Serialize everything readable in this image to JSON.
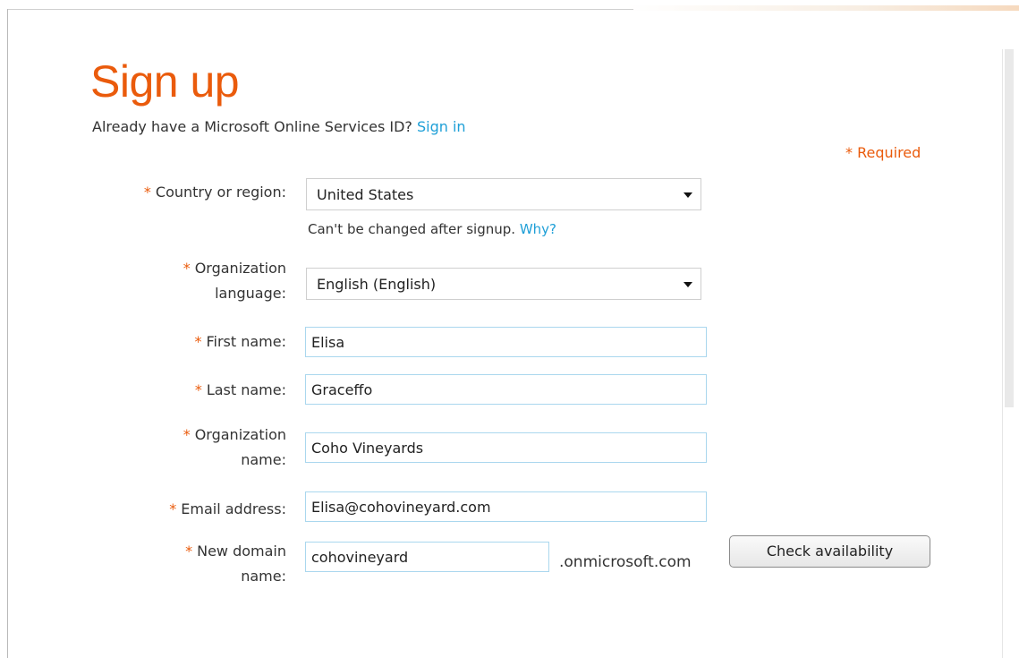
{
  "page": {
    "title": "Sign up",
    "subtitle_text": "Already have a Microsoft Online Services ID?",
    "signin_link": "Sign in",
    "required_note": "* Required"
  },
  "form": {
    "required_marker": "*",
    "country": {
      "label": "Country or region:",
      "value": "United States",
      "help_text": "Can't be changed after signup.",
      "help_link": "Why?"
    },
    "language": {
      "label_line1": "Organization",
      "label_line2": "language:",
      "value": "English (English)"
    },
    "first_name": {
      "label": "First name:",
      "value": "Elisa"
    },
    "last_name": {
      "label": "Last name:",
      "value": "Graceffo"
    },
    "organization_name": {
      "label_line1": "Organization",
      "label_line2": "name:",
      "value": "Coho Vineyards"
    },
    "email": {
      "label": "Email address:",
      "value": "Elisa@cohovineyard.com"
    },
    "domain": {
      "label_line1": "New domain",
      "label_line2": "name:",
      "value": "cohovineyard",
      "suffix": ".onmicrosoft.com",
      "check_button": "Check availability"
    }
  },
  "colors": {
    "accent": "#ea5b0c",
    "link": "#1e9fd7",
    "input_border": "#aad7ee"
  }
}
